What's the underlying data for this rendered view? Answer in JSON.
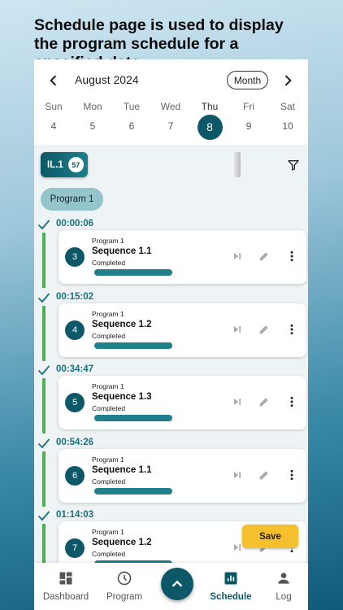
{
  "headline": "Schedule page is used to display the program schedule for a specified date",
  "calendar": {
    "month_label": "August 2024",
    "view_button": "Month",
    "days": [
      {
        "name": "Sun",
        "date": "4"
      },
      {
        "name": "Mon",
        "date": "5"
      },
      {
        "name": "Tue",
        "date": "6"
      },
      {
        "name": "Wed",
        "date": "7"
      },
      {
        "name": "Thu",
        "date": "8"
      },
      {
        "name": "Fri",
        "date": "9"
      },
      {
        "name": "Sat",
        "date": "10"
      }
    ],
    "selected_index": 4
  },
  "filter": {
    "line_label": "IL.1",
    "line_count": "57"
  },
  "program_chip": "Program 1",
  "entries": [
    {
      "time": "00:00:06",
      "number": "3",
      "program": "Program 1",
      "sequence": "Sequence 1.1",
      "status": "Completed",
      "progress": 1.0
    },
    {
      "time": "00:15:02",
      "number": "4",
      "program": "Program 1",
      "sequence": "Sequence 1.2",
      "status": "Completed",
      "progress": 1.0
    },
    {
      "time": "00:34:47",
      "number": "5",
      "program": "Program 1",
      "sequence": "Sequence 1.3",
      "status": "Completed",
      "progress": 1.0
    },
    {
      "time": "00:54:26",
      "number": "6",
      "program": "Program 1",
      "sequence": "Sequence 1.1",
      "status": "Completed",
      "progress": 1.0
    },
    {
      "time": "01:14:03",
      "number": "7",
      "program": "Program 1",
      "sequence": "Sequence 1.2",
      "status": "Completed",
      "progress": 1.0
    }
  ],
  "save_label": "Save",
  "nav": {
    "dashboard": "Dashboard",
    "program": "Program",
    "schedule": "Schedule",
    "log": "Log",
    "active": "schedule"
  },
  "colors": {
    "primary": "#0d5868",
    "accent": "#f6bf2e",
    "success": "#4caf50",
    "progress": "#20808c"
  }
}
